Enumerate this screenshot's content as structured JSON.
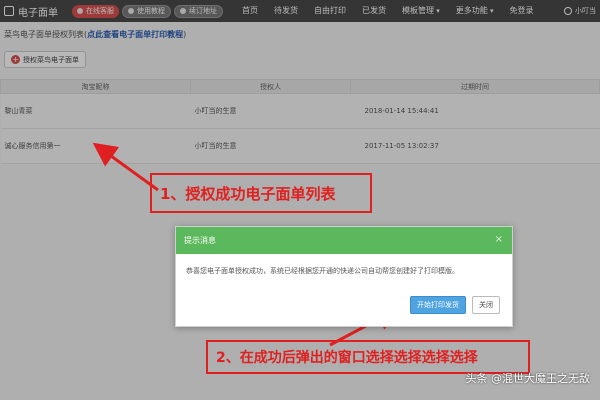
{
  "topbar": {
    "title": "电子面单",
    "pills": [
      "在线客服",
      "使用教程",
      "续订地址"
    ],
    "nav": [
      "首页",
      "待发货",
      "自由打印",
      "已发货",
      "模板管理",
      "更多功能",
      "免登录"
    ],
    "user": "小叮当"
  },
  "page": {
    "hint_prefix": "菜鸟电子面单授权列表(",
    "hint_link": "点此查看电子面单打印教程",
    "hint_suffix": ")",
    "auth_button": "授权菜鸟电子面单"
  },
  "table": {
    "headers": [
      "淘宝昵称",
      "授权人",
      "过期时间"
    ],
    "rows": [
      [
        "黎山青菜",
        "小叮当的生意",
        "2018-01-14 15:44:41"
      ],
      [
        "诚心服务信用第一",
        "小叮当的生意",
        "2017-11-05 13:02:37"
      ]
    ]
  },
  "annotations": {
    "step1": "1、授权成功电子面单列表",
    "step2": "2、在成功后弹出的窗口选择选择选择选择"
  },
  "dialog": {
    "title": "提示消息",
    "close": "×",
    "message": "恭喜您电子面单授权成功，系统已经根据您开通的快递公司自动帮您创建好了打印模版。",
    "primary_button": "开始打印发货",
    "close_button": "关闭"
  },
  "watermark": "头条 @混世大魔王之无敌",
  "colors": {
    "topbar": "#4a4a4a",
    "dialog_header": "#5cb85c",
    "primary_button": "#4fa3e0",
    "annotation": "#e02020"
  }
}
